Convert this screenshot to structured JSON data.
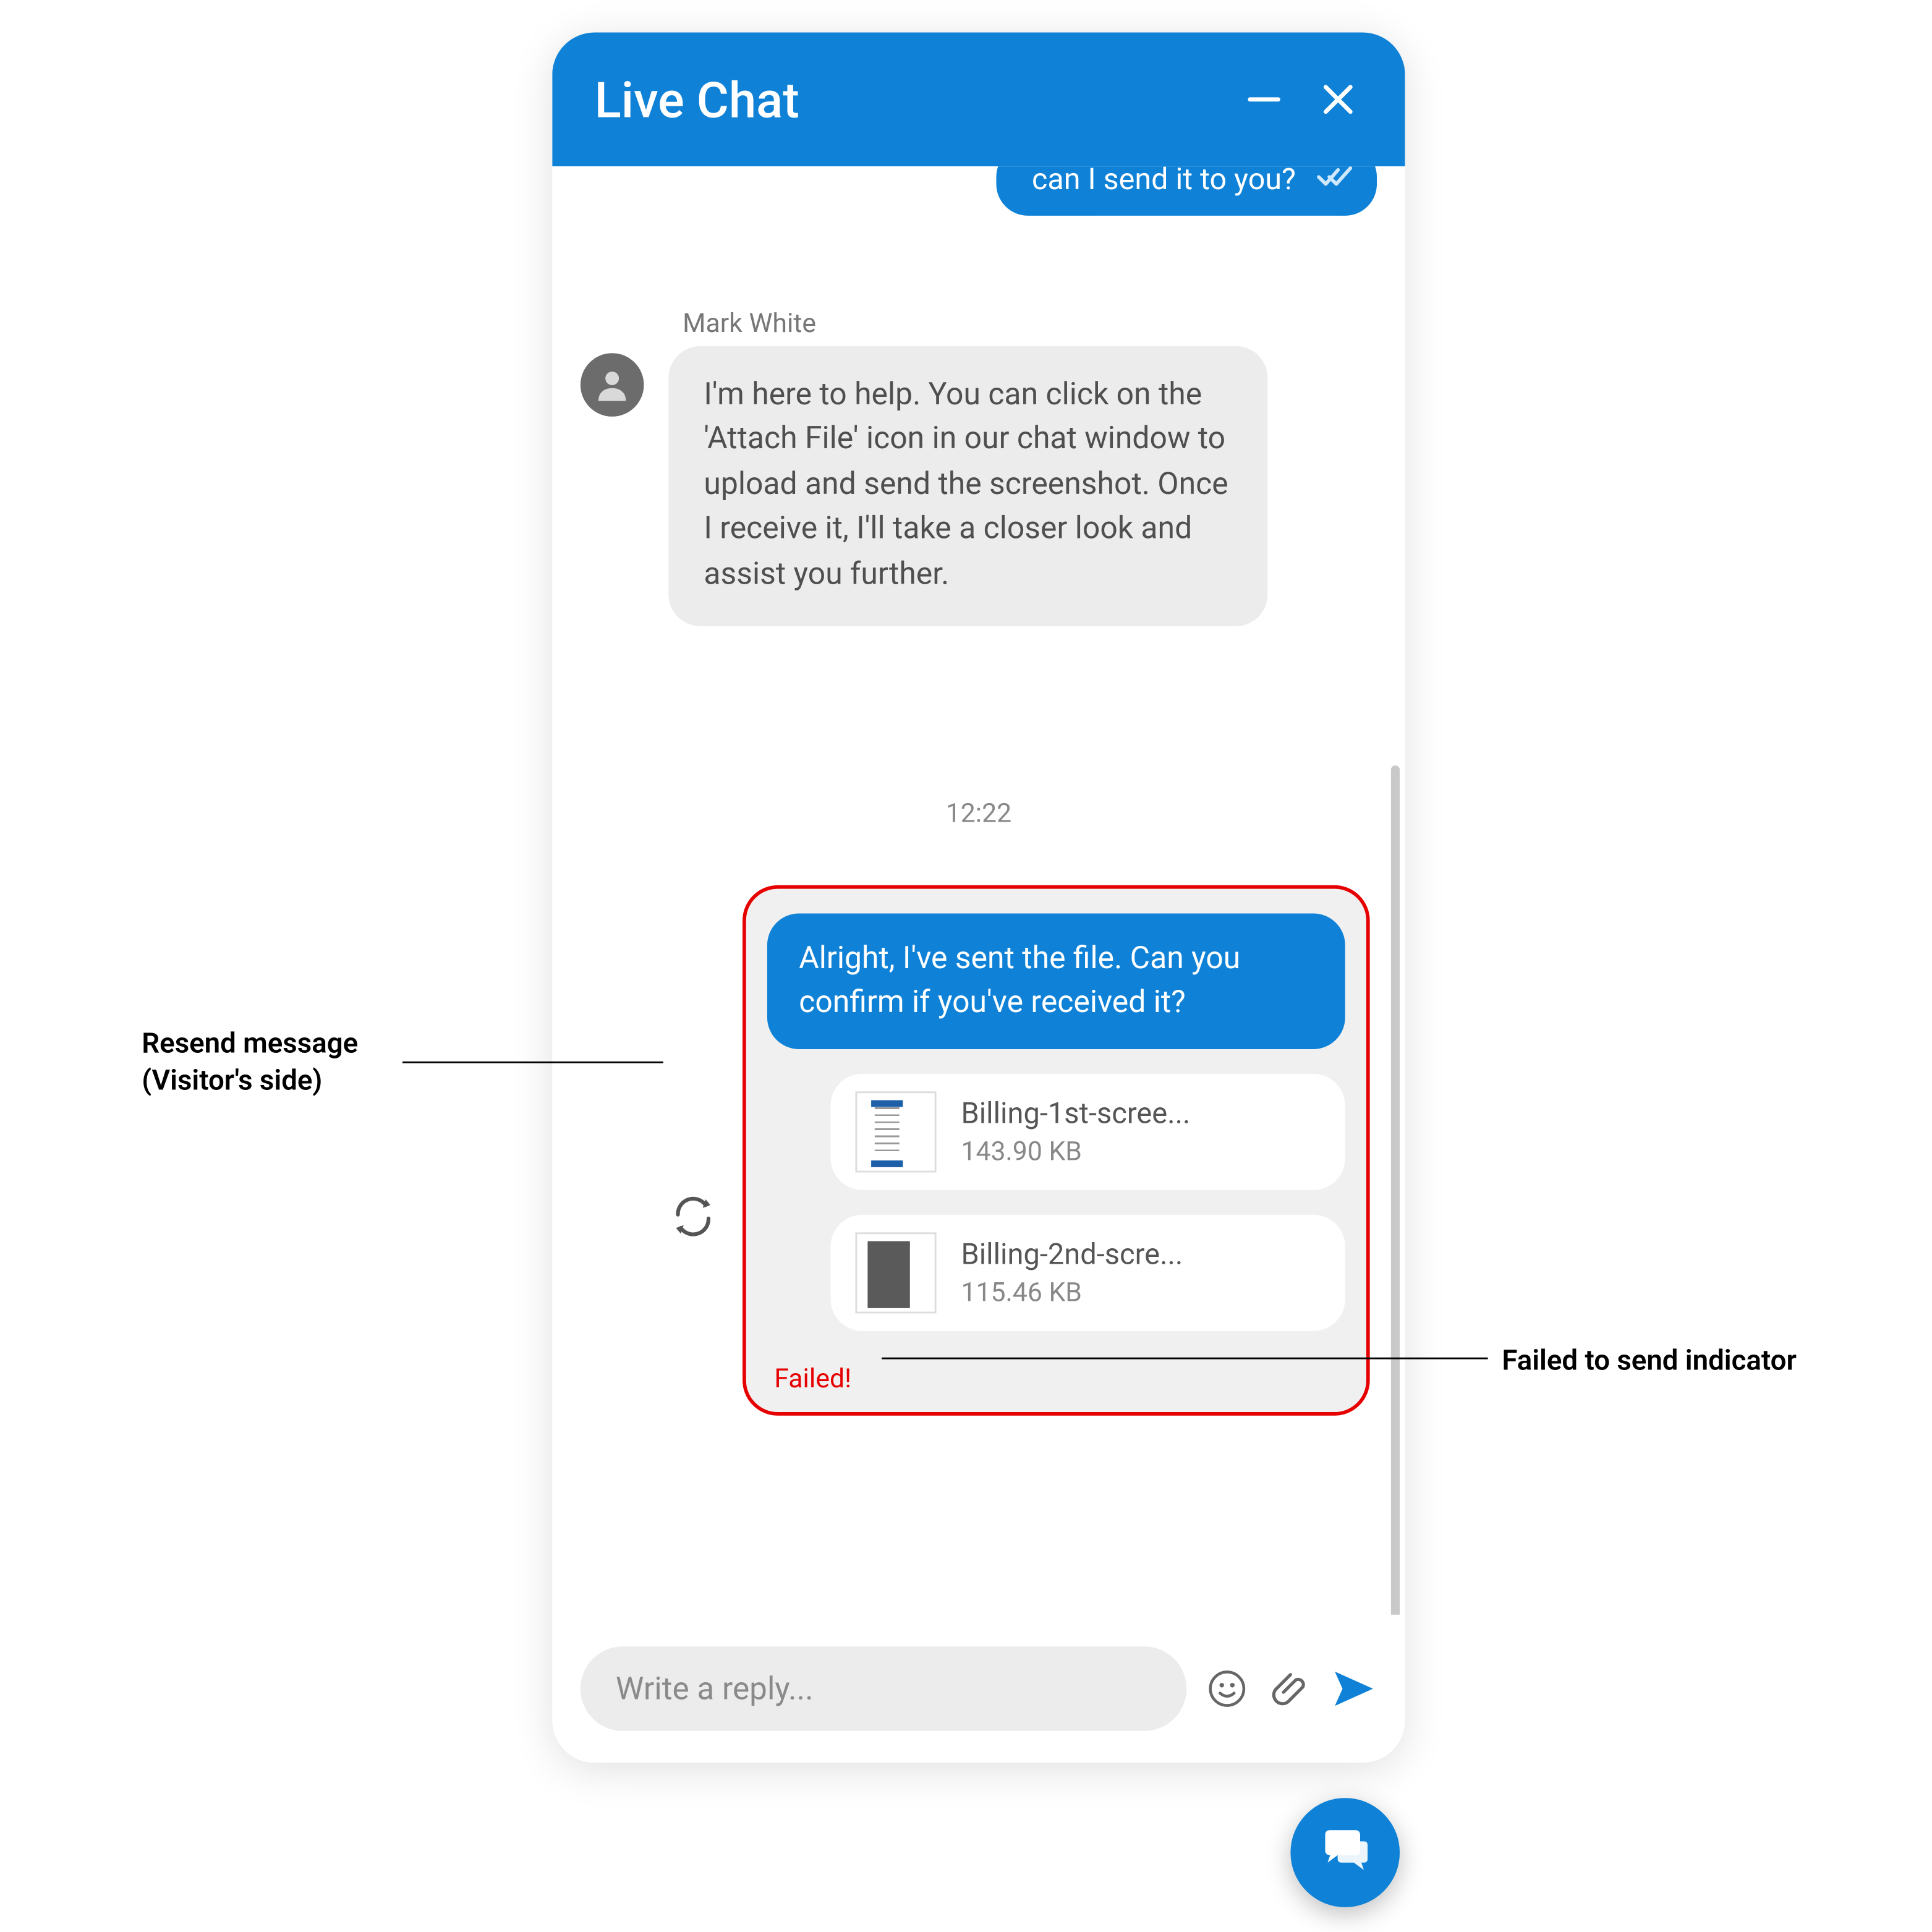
{
  "header": {
    "title": "Live Chat"
  },
  "partial_outgoing": {
    "text": "can I send it to you?"
  },
  "agent": {
    "name": "Mark White",
    "text": "I'm here to help. You can click on the 'Attach File' icon in our chat window to upload and send the screenshot. Once I receive it, I'll take a closer look and assist you further."
  },
  "timestamp": "12:22",
  "failed_group": {
    "message": "Alright, I've sent the file. Can you confirm if you've received it?",
    "attachments": [
      {
        "name": "Billing-1st-scree...",
        "size": "143.90 KB"
      },
      {
        "name": "Billing-2nd-scre...",
        "size": "115.46 KB"
      }
    ],
    "status": "Failed!"
  },
  "composer": {
    "placeholder": "Write a reply..."
  },
  "annotations": {
    "resend_l1": "Resend message",
    "resend_l2": "(Visitor's side)",
    "failed": "Failed to send indicator"
  }
}
